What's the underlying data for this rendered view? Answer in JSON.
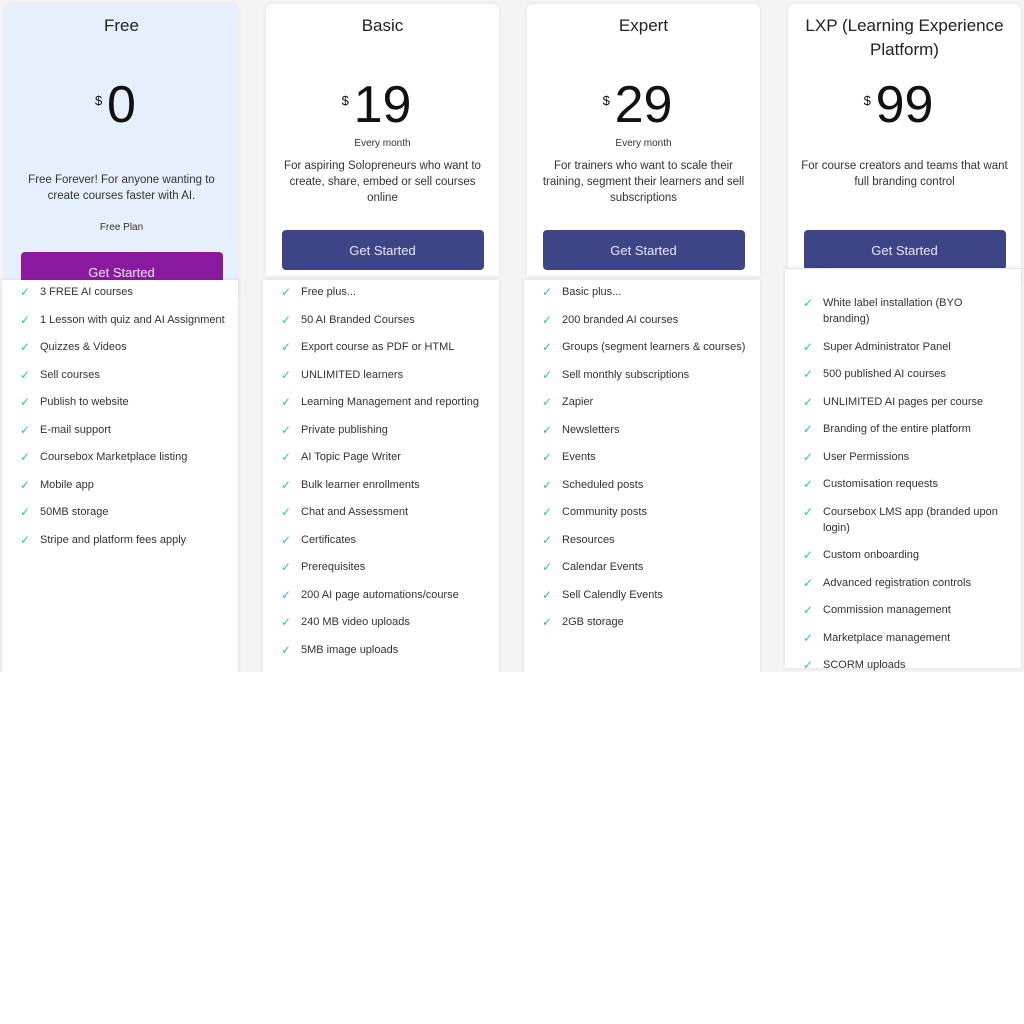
{
  "plans": [
    {
      "name": "Free",
      "currency": "$",
      "price": "0",
      "period": "",
      "description": "Free Forever! For anyone wanting to create courses faster with AI.",
      "subtitle": "Free Plan",
      "cta": "Get Started",
      "features": [
        "3 FREE AI courses",
        "1 Lesson with quiz and AI Assignment",
        "Quizzes & Videos",
        "Sell courses",
        "Publish to website",
        "E-mail support",
        "Coursebox Marketplace listing",
        "Mobile app",
        "50MB storage",
        "Stripe and platform fees apply"
      ]
    },
    {
      "name": "Basic",
      "currency": "$",
      "price": "19",
      "period": "Every month",
      "description": "For aspiring Solopreneurs who want to create, share, embed or sell courses online",
      "cta": "Get Started",
      "features": [
        "Free plus...",
        "50 AI Branded Courses",
        "Export course as PDF or HTML",
        "UNLIMITED learners",
        "Learning Management and reporting",
        "Private publishing",
        "AI Topic Page Writer",
        "Bulk learner enrollments",
        "Chat and Assessment",
        "Certificates",
        "Prerequisites",
        "200 AI page automations/course",
        "240 MB video uploads",
        "5MB image uploads"
      ]
    },
    {
      "name": "Expert",
      "currency": "$",
      "price": "29",
      "period": "Every month",
      "description": "For trainers who want to scale their training, segment their learners and sell subscriptions",
      "cta": "Get Started",
      "features": [
        "Basic plus...",
        "200 branded AI courses",
        "Groups (segment learners & courses)",
        "Sell monthly subscriptions",
        "Zapier",
        "Newsletters",
        "Events",
        "Scheduled posts",
        "Community posts",
        "Resources",
        "Calendar Events",
        "Sell Calendly Events",
        "2GB storage"
      ]
    },
    {
      "name": "LXP (Learning Experience Platform)",
      "currency": "$",
      "price": "99",
      "period": "",
      "description": "For course creators and teams that want full branding control",
      "cta": "Get Started",
      "features": [
        "White label installation (BYO branding)",
        "Super Administrator Panel",
        "500 published AI courses",
        "UNLIMITED AI pages per course",
        "Branding of the entire platform",
        "User Permissions",
        "Customisation requests",
        "Coursebox LMS app (branded upon login)",
        "Custom onboarding",
        "Advanced registration controls",
        "Commission management",
        "Marketplace management",
        "SCORM uploads"
      ]
    }
  ],
  "colors": {
    "free_button": "#8a1ba1",
    "button": "#3e4587",
    "check": "#27c0d8",
    "free_bg": "#e6f0fc"
  },
  "icons": {
    "feature": "check-icon"
  }
}
